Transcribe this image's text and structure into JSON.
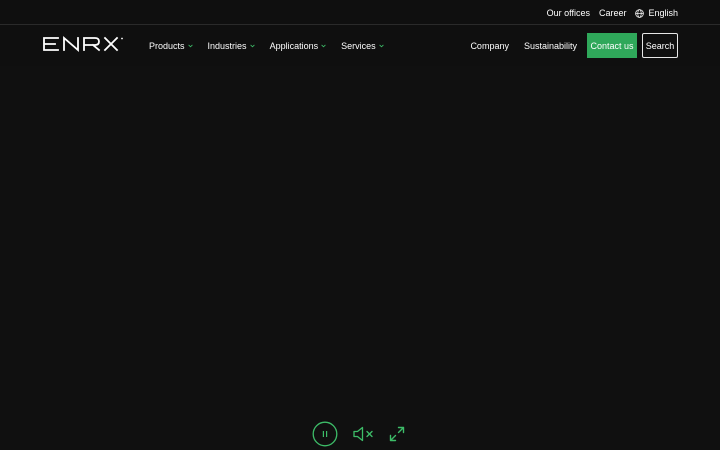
{
  "colors": {
    "background": "#0f0f0f",
    "accent": "#3dbc68",
    "contact_button": "#2fa85a",
    "text": "#ffffff"
  },
  "topbar": {
    "offices": "Our offices",
    "career": "Career",
    "language": "English",
    "language_icon": "globe-icon"
  },
  "header": {
    "logo_text": "ENRX",
    "menu": [
      {
        "label": "Products",
        "icon": "chevron-down-icon"
      },
      {
        "label": "Industries",
        "icon": "chevron-down-icon"
      },
      {
        "label": "Applications",
        "icon": "chevron-down-icon"
      },
      {
        "label": "Services",
        "icon": "chevron-down-icon"
      }
    ],
    "company": "Company",
    "sustainability": "Sustainability",
    "contact": "Contact us",
    "search": "Search"
  },
  "video_controls": {
    "pause_icon": "pause-icon",
    "mute_icon": "volume-muted-icon",
    "fullscreen_icon": "fullscreen-icon"
  }
}
